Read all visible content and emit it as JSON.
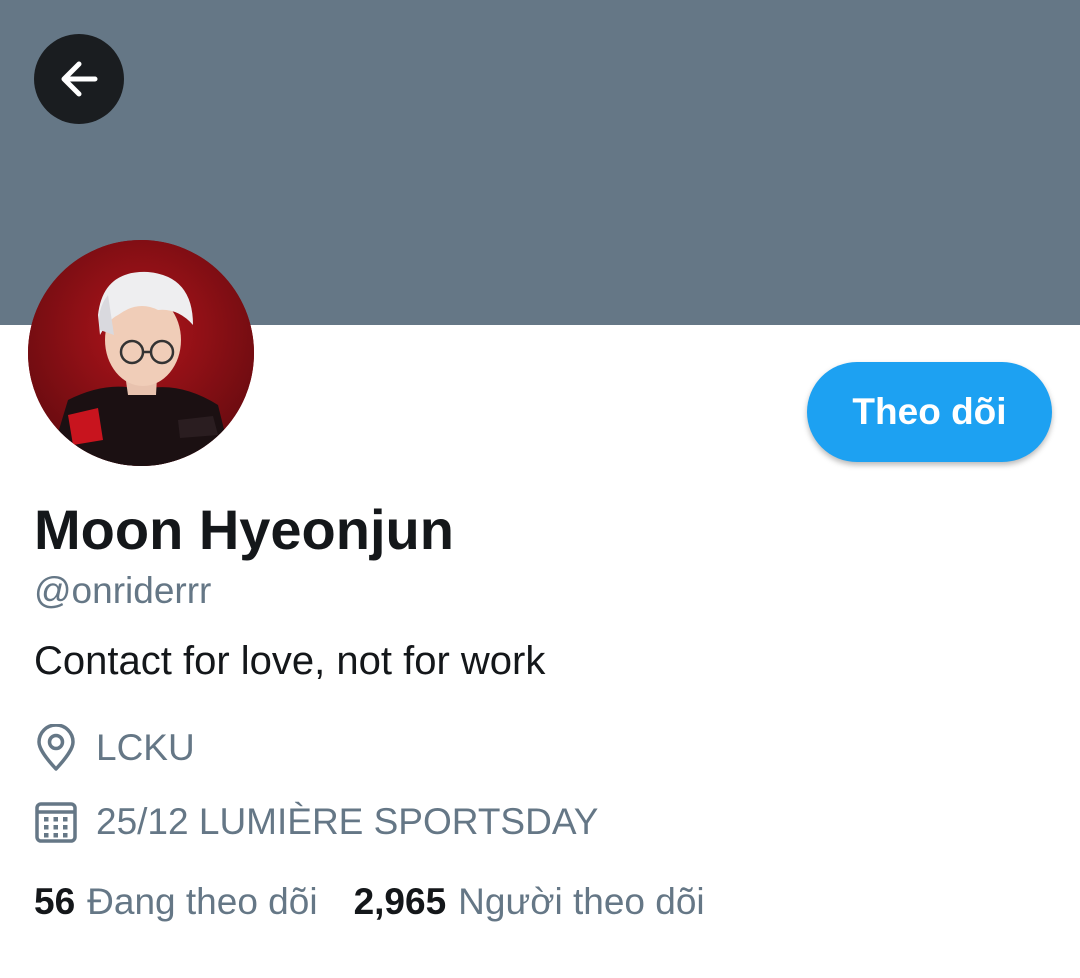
{
  "colors": {
    "banner": "#657786",
    "accent": "#1da1f2",
    "text_primary": "#14171a",
    "text_secondary": "#657786"
  },
  "header": {
    "back_icon": "arrow-left-icon"
  },
  "profile": {
    "avatar_icon": "profile-photo",
    "follow_label": "Theo dõi",
    "display_name": "Moon Hyeonjun",
    "handle": "@onriderrr",
    "bio": "Contact for love, not for work",
    "location_icon": "location-pin-icon",
    "location": "LCKU",
    "joined_icon": "calendar-icon",
    "joined": "25/12 LUMIÈRE SPORTSDAY"
  },
  "stats": {
    "following_count": "56",
    "following_label": "Đang theo dõi",
    "followers_count": "2,965",
    "followers_label": "Người theo dõi"
  }
}
